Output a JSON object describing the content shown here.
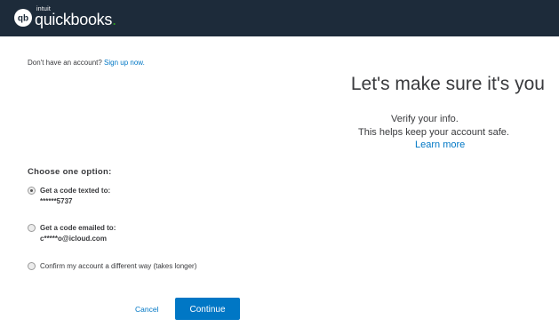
{
  "brand": {
    "intuit": "intuit",
    "name": "quickbooks",
    "dot": ".",
    "icon": "qb-icon",
    "colors": {
      "topbar": "#1d2b3a",
      "accent": "#2ca01c",
      "link": "#0077c5"
    }
  },
  "signup": {
    "prompt": "Don't have an account?",
    "link": "Sign up now."
  },
  "hero": {
    "heading": "Let's make sure it's you",
    "line1": "Verify your info.",
    "line2": "This helps keep your account safe.",
    "learn_more": "Learn more"
  },
  "options": {
    "label": "Choose one option:",
    "items": [
      {
        "title": "Get a code texted to:",
        "value": "******5737",
        "selected": true
      },
      {
        "title": "Get a code emailed to:",
        "value": "c*****o@icloud.com",
        "selected": false
      },
      {
        "title": "Confirm my account a different way (takes longer)",
        "selected": false
      }
    ]
  },
  "actions": {
    "cancel": "Cancel",
    "continue": "Continue"
  }
}
